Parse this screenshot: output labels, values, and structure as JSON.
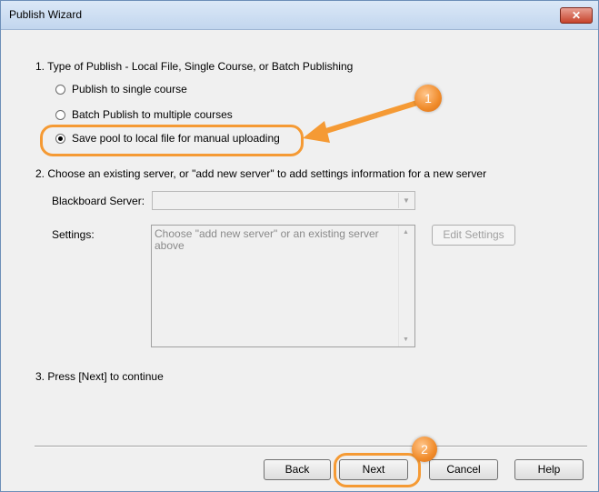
{
  "window": {
    "title": "Publish Wizard",
    "close_glyph": "✕"
  },
  "step1": {
    "heading": "1.  Type of Publish - Local File, Single Course, or Batch Publishing",
    "options": [
      {
        "label": "Publish to single course",
        "selected": false
      },
      {
        "label": "Batch Publish to multiple courses",
        "selected": false
      },
      {
        "label": "Save pool to local file for manual uploading",
        "selected": true
      }
    ]
  },
  "step2": {
    "heading": "2.  Choose an existing server, or \"add new server\" to add settings information for a new server",
    "server_label": "Blackboard Server:",
    "server_value": "",
    "settings_label": "Settings:",
    "settings_text": "Choose \"add new server\" or an existing server above",
    "edit_settings_label": "Edit Settings"
  },
  "step3": {
    "heading": "3.  Press [Next] to continue"
  },
  "buttons": {
    "back": "Back",
    "next": "Next",
    "cancel": "Cancel",
    "help": "Help"
  },
  "callouts": {
    "one": "1",
    "two": "2",
    "color": "#f59a34"
  }
}
